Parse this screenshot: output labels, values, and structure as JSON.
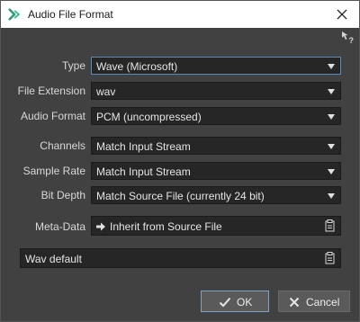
{
  "window": {
    "title": "Audio File Format",
    "logo_icon": "wavelab-logo-icon",
    "close_icon": "close-icon",
    "help_icon": "context-help-icon"
  },
  "form": {
    "type": {
      "label": "Type",
      "value": "Wave (Microsoft)"
    },
    "file_extension": {
      "label": "File Extension",
      "value": "wav"
    },
    "audio_format": {
      "label": "Audio Format",
      "value": "PCM (uncompressed)"
    },
    "channels": {
      "label": "Channels",
      "value": "Match Input Stream"
    },
    "sample_rate": {
      "label": "Sample Rate",
      "value": "Match Input Stream"
    },
    "bit_depth": {
      "label": "Bit Depth",
      "value": "Match Source File (currently 24 bit)"
    },
    "meta_data": {
      "label": "Meta-Data",
      "value": "Inherit from Source File",
      "icon": "arrow-right-icon"
    }
  },
  "preset": {
    "value": "Wav default",
    "icon": "clipboard-icon"
  },
  "buttons": {
    "ok": {
      "label": "OK",
      "icon": "check-icon"
    },
    "cancel": {
      "label": "Cancel",
      "icon": "x-icon"
    }
  },
  "colors": {
    "accent": "#5a8ab8",
    "background": "#414141",
    "field": "#262626",
    "titlebar": "#ffffff"
  }
}
